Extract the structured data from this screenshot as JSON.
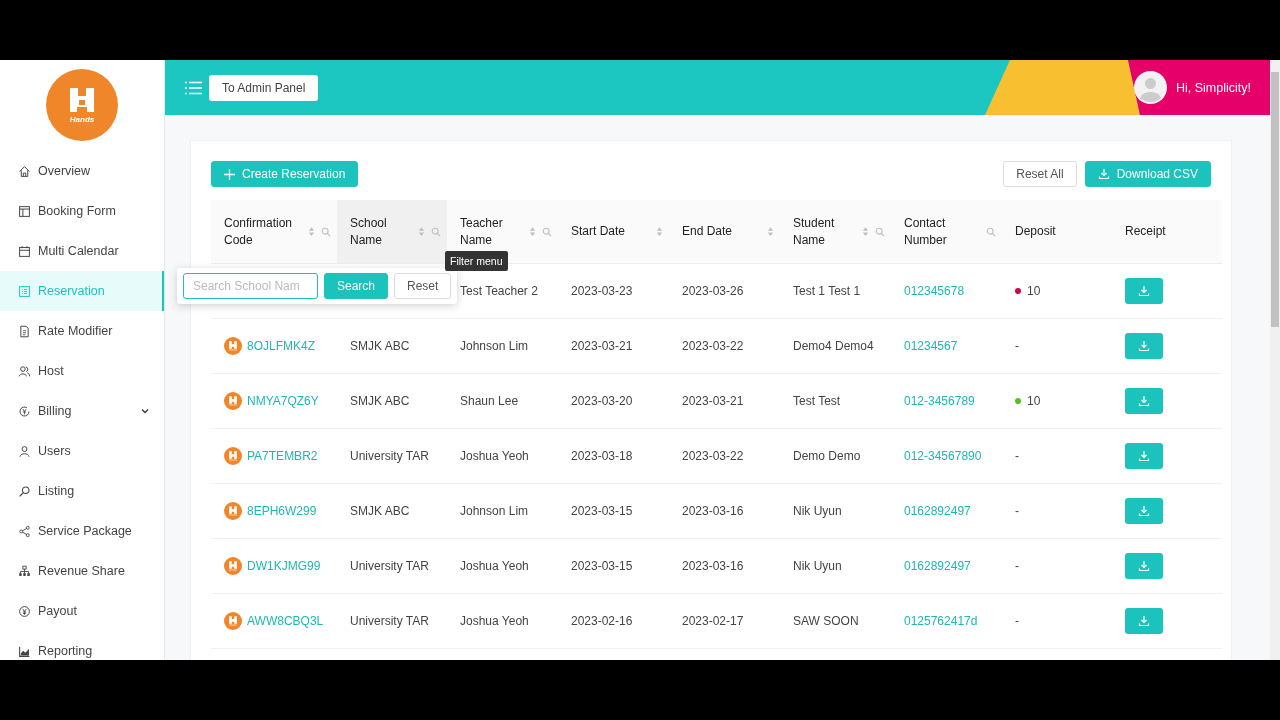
{
  "logo": {
    "text": "Hands"
  },
  "sidebar": {
    "items": [
      {
        "label": "Overview",
        "selected": false
      },
      {
        "label": "Booking Form",
        "selected": false
      },
      {
        "label": "Multi Calendar",
        "selected": false
      },
      {
        "label": "Reservation",
        "selected": true
      },
      {
        "label": "Rate Modifier",
        "selected": false
      },
      {
        "label": "Host",
        "selected": false
      },
      {
        "label": "Billing",
        "selected": false,
        "expanded": false
      },
      {
        "label": "Users",
        "selected": false
      },
      {
        "label": "Listing",
        "selected": false
      },
      {
        "label": "Service Package",
        "selected": false
      },
      {
        "label": "Revenue Share",
        "selected": false
      },
      {
        "label": "Payout",
        "selected": false
      },
      {
        "label": "Reporting",
        "selected": false
      }
    ]
  },
  "header": {
    "admin_button": "To Admin Panel",
    "greeting": "Hi, Simplicity!"
  },
  "toolbar": {
    "create_button": "Create Reservation",
    "reset_button": "Reset All",
    "download_button": "Download CSV"
  },
  "table": {
    "columns": [
      {
        "label": "Confirmation Code",
        "sortable": true,
        "filterable": true
      },
      {
        "label": "School Name",
        "sortable": true,
        "filterable": true
      },
      {
        "label": "Teacher Name",
        "sortable": true,
        "filterable": true
      },
      {
        "label": "Start Date",
        "sortable": true,
        "filterable": false
      },
      {
        "label": "End Date",
        "sortable": true,
        "filterable": false
      },
      {
        "label": "Student Name",
        "sortable": true,
        "filterable": true
      },
      {
        "label": "Contact Number",
        "sortable": false,
        "filterable": true
      },
      {
        "label": "Deposit",
        "sortable": false,
        "filterable": false
      },
      {
        "label": "Receipt",
        "sortable": false,
        "filterable": false
      }
    ],
    "rows": [
      {
        "code": "",
        "school": "",
        "teacher": "Test Teacher 2",
        "start": "2023-03-23",
        "end": "2023-03-26",
        "student": "Test 1 Test 1",
        "contact": "012345678",
        "deposit": {
          "text": "10",
          "color": "#d1063f"
        }
      },
      {
        "code": "8OJLFMK4Z",
        "school": "SMJK ABC",
        "teacher": "Johnson Lim",
        "start": "2023-03-21",
        "end": "2023-03-22",
        "student": "Demo4 Demo4",
        "contact": "01234567",
        "deposit": {
          "text": "-"
        }
      },
      {
        "code": "NMYA7QZ6Y",
        "school": "SMJK ABC",
        "teacher": "Shaun Lee",
        "start": "2023-03-20",
        "end": "2023-03-21",
        "student": "Test Test",
        "contact": "012-3456789",
        "deposit": {
          "text": "10",
          "color": "#52c41a"
        }
      },
      {
        "code": "PA7TEMBR2",
        "school": "University TAR",
        "teacher": "Joshua Yeoh",
        "start": "2023-03-18",
        "end": "2023-03-22",
        "student": "Demo Demo",
        "contact": "012-34567890",
        "deposit": {
          "text": "-"
        }
      },
      {
        "code": "8EPH6W299",
        "school": "SMJK ABC",
        "teacher": "Johnson Lim",
        "start": "2023-03-15",
        "end": "2023-03-16",
        "student": "Nik Uyun",
        "contact": "0162892497",
        "deposit": {
          "text": "-"
        }
      },
      {
        "code": "DW1KJMG99",
        "school": "University TAR",
        "teacher": "Joshua Yeoh",
        "start": "2023-03-15",
        "end": "2023-03-16",
        "student": "Nik Uyun",
        "contact": "0162892497",
        "deposit": {
          "text": "-"
        }
      },
      {
        "code": "AWW8CBQ3L",
        "school": "University TAR",
        "teacher": "Joshua Yeoh",
        "start": "2023-02-16",
        "end": "2023-02-17",
        "student": "SAW SOON",
        "contact": "0125762417d",
        "deposit": {
          "text": "-"
        }
      }
    ]
  },
  "filter_popup": {
    "placeholder": "Search School Nam",
    "search_button": "Search",
    "reset_button": "Reset"
  },
  "tooltip": "Filter menu"
}
